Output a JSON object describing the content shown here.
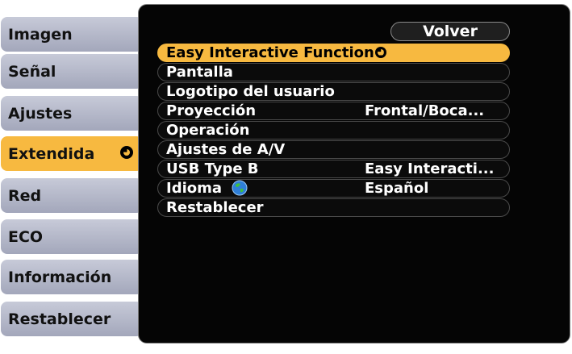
{
  "sidebar": {
    "items": [
      {
        "label": "Imagen"
      },
      {
        "label": "Señal"
      },
      {
        "label": "Ajustes"
      },
      {
        "label": "Extendida",
        "selected": true
      },
      {
        "label": "Red"
      },
      {
        "label": "ECO"
      },
      {
        "label": "Información"
      },
      {
        "label": "Restablecer"
      }
    ],
    "selected_indicator_icon": "enter-icon"
  },
  "main": {
    "back_label": "Volver",
    "rows": [
      {
        "label": "Easy Interactive Function",
        "value": "",
        "highlighted": true,
        "icon": "enter-icon"
      },
      {
        "label": "Pantalla",
        "value": ""
      },
      {
        "label": "Logotipo del usuario",
        "value": ""
      },
      {
        "label": "Proyección",
        "value": "Frontal/Boca..."
      },
      {
        "label": "Operación",
        "value": ""
      },
      {
        "label": "Ajustes de A/V",
        "value": ""
      },
      {
        "label": "USB Type B",
        "value": "Easy Interacti..."
      },
      {
        "label": "Idioma",
        "value": "Español",
        "icon": "globe-icon"
      },
      {
        "label": "Restablecer",
        "value": ""
      }
    ]
  },
  "colors": {
    "highlight": "#f7b940",
    "tab_inactive": "#b6b9ca",
    "panel": "#050505"
  }
}
